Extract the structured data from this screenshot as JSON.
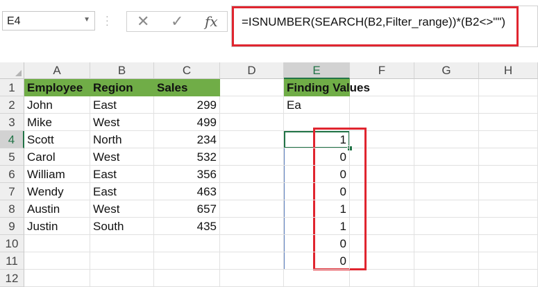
{
  "name_box": {
    "value": "E4",
    "dropdown_icon": "chevron-down-icon"
  },
  "formula_bar": {
    "cancel_icon": "close-icon",
    "enter_icon": "check-icon",
    "fx_label": "fx",
    "formula": "=ISNUMBER(SEARCH(B2,Filter_range))*(B2<>\"\")",
    "highlight_color": "#e0252f"
  },
  "active_cell": "E4",
  "columns": [
    "A",
    "B",
    "C",
    "D",
    "E",
    "F",
    "G",
    "H"
  ],
  "rows": [
    "1",
    "2",
    "3",
    "4",
    "5",
    "6",
    "7",
    "8",
    "9",
    "10",
    "11",
    "12"
  ],
  "table": {
    "headers": [
      "Employee",
      "Region",
      "Sales"
    ],
    "header_color": "#70ad47",
    "data": [
      [
        "John",
        "East",
        "299"
      ],
      [
        "Mike",
        "West",
        "499"
      ],
      [
        "Scott",
        "North",
        "234"
      ],
      [
        "Carol",
        "West",
        "532"
      ],
      [
        "William",
        "East",
        "356"
      ],
      [
        "Wendy",
        "East",
        "463"
      ],
      [
        "Austin",
        "West",
        "657"
      ],
      [
        "Justin",
        "South",
        "435"
      ]
    ]
  },
  "finding": {
    "header": "Finding Values",
    "value": "Ea"
  },
  "results": [
    "1",
    "0",
    "0",
    "0",
    "1",
    "1",
    "0",
    "0"
  ]
}
